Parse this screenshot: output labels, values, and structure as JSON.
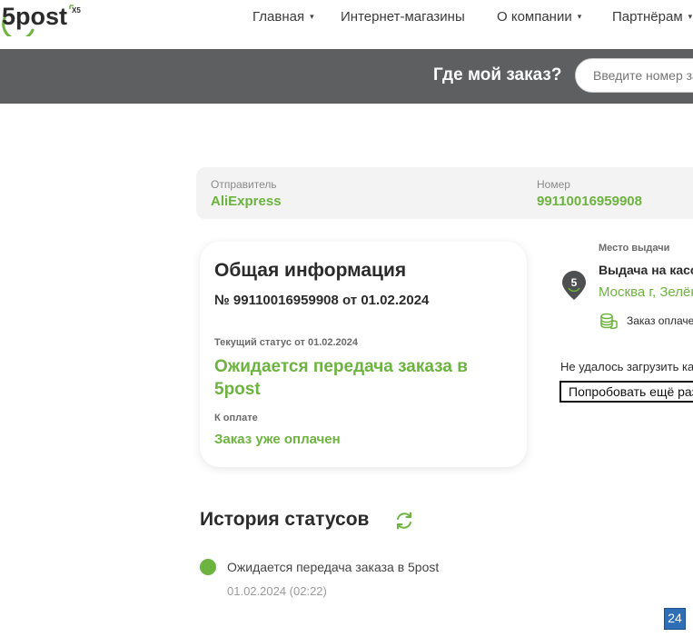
{
  "header": {
    "logo_text": "5post",
    "logo_sub": "X5",
    "nav": [
      {
        "label": "Главная",
        "has_dropdown": true
      },
      {
        "label": "Интернет-магазины",
        "has_dropdown": false
      },
      {
        "label": "О компании",
        "has_dropdown": true
      },
      {
        "label": "Партнёрам",
        "has_dropdown": true
      }
    ],
    "dropdown_icon": "▾"
  },
  "search": {
    "label": "Где мой заказ?",
    "placeholder": "Введите номер заказа"
  },
  "order_strip": {
    "sender_label": "Отправитель",
    "sender_value": "AliExpress",
    "number_label": "Номер",
    "number_value": "99110016959908"
  },
  "general": {
    "title": "Общая информация",
    "number_line": "№ 99110016959908 от 01.02.2024",
    "status_label": "Текущий статус от 01.02.2024",
    "status_value": "Ожидается передача заказа в 5post",
    "payment_label": "К оплате",
    "payment_value": "Заказ уже оплачен"
  },
  "pickup": {
    "label": "Место выдачи",
    "name": "Выдача на кассе",
    "address": "Москва г, Зелёный",
    "payment_note": "Заказ оплачен",
    "pin_icon": "map-pin-5",
    "coins_icon": "coins-icon"
  },
  "map_error": {
    "text": "Не удалось загрузить карту",
    "retry_label": "Попробовать ещё раз"
  },
  "history": {
    "title": "История статусов",
    "refresh_icon": "refresh-icon",
    "items": [
      {
        "text": "Ожидается передача заказа в 5post",
        "time": "01.02.2024 (02:22)"
      }
    ]
  },
  "badge": {
    "text": "24"
  },
  "colors": {
    "brand_green": "#6cb33f",
    "header_gray": "#5e5f61",
    "strip_bg": "#f3f3f3"
  }
}
